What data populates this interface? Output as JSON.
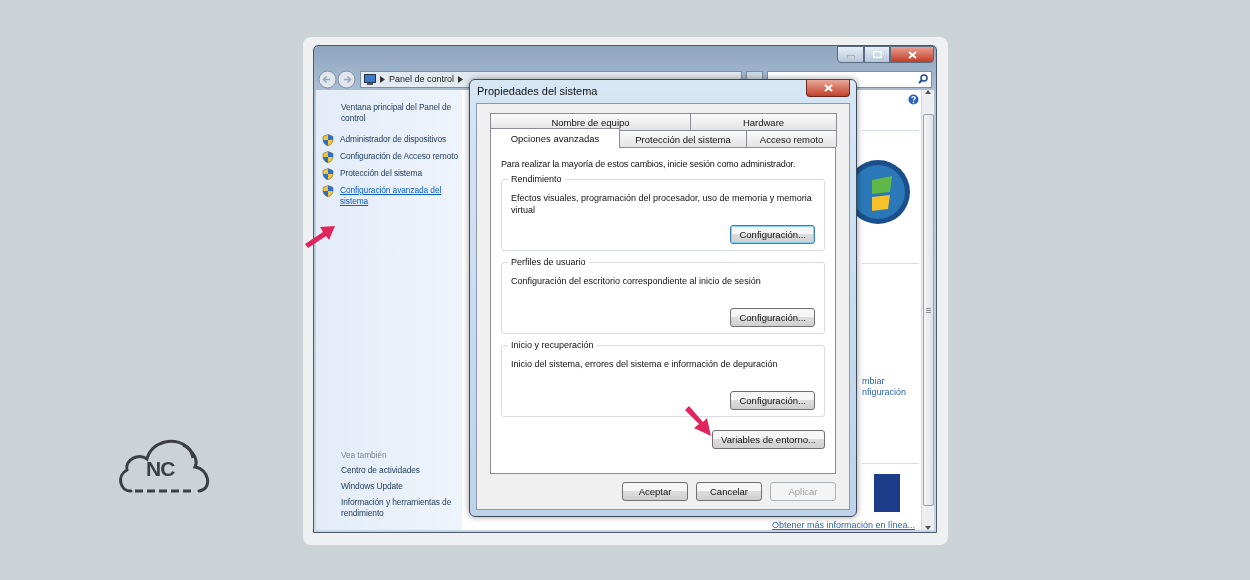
{
  "logo": {
    "text": "NC"
  },
  "explorer": {
    "breadcrumb": [
      "Panel de control"
    ],
    "sidebar": {
      "home_link": "Ventana principal del Panel de control",
      "tasks": [
        {
          "label": "Administrador de dispositivos",
          "selected": false
        },
        {
          "label": "Configuración de Acceso remoto",
          "selected": false
        },
        {
          "label": "Protección del sistema",
          "selected": false
        },
        {
          "label": "Configuración avanzada del sistema",
          "selected": true
        }
      ],
      "see_also_heading": "Vea también",
      "see_also": [
        "Centro de actividades",
        "Windows Update",
        "Información y herramientas de rendimiento"
      ]
    },
    "content_links": [
      "mbiar",
      "nfiguración"
    ],
    "footer_link": "Obtener más información en línea..."
  },
  "dialog": {
    "title": "Propiedades del sistema",
    "tab_rows": [
      [
        {
          "label": "Nombre de equipo",
          "selected": false
        },
        {
          "label": "Hardware",
          "selected": false
        }
      ],
      [
        {
          "label": "Opciones avanzadas",
          "selected": true
        },
        {
          "label": "Protección del sistema",
          "selected": false
        },
        {
          "label": "Acceso remoto",
          "selected": false
        }
      ]
    ],
    "notice": "Para realizar la mayoría de estos cambios, inicie sesión como administrador.",
    "groups": [
      {
        "title": "Rendimiento",
        "description": "Efectos visuales, programación del procesador, uso de memoria y memoria virtual",
        "button": "Configuración...",
        "focused": true
      },
      {
        "title": "Perfiles de usuario",
        "description": "Configuración del escritorio correspondiente al inicio de sesión",
        "button": "Configuración...",
        "focused": false
      },
      {
        "title": "Inicio y recuperación",
        "description": "Inicio del sistema, errores del sistema e información de depuración",
        "button": "Configuración...",
        "focused": false
      }
    ],
    "env_button": "Variables de entorno...",
    "buttons": [
      {
        "label": "Aceptar",
        "disabled": false
      },
      {
        "label": "Cancelar",
        "disabled": false
      },
      {
        "label": "Aplicar",
        "disabled": true
      }
    ]
  }
}
